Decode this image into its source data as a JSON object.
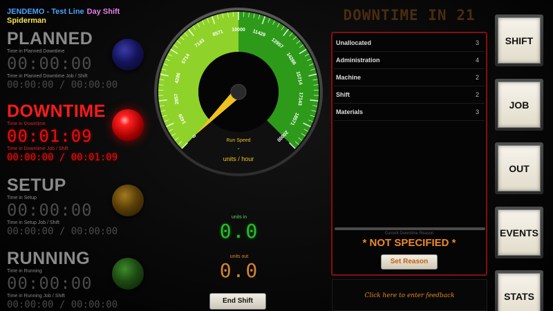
{
  "header": {
    "site": "JENDEMO",
    "separator": " - ",
    "line": "Test Line",
    "shift": "Day Shift",
    "user": "Spiderman"
  },
  "status_blocks": [
    {
      "key": "planned",
      "title": "PLANNED",
      "time_label": "Time in Planned Downtime",
      "time": "00:00:00",
      "job_label": "Time in Planned Downtime Job / Shift",
      "job_time": "00:00:00 / 00:00:00",
      "lamp": "blue",
      "active": false
    },
    {
      "key": "downtime",
      "title": "DOWNTIME",
      "time_label": "Time in Downtime",
      "time": "00:01:09",
      "job_label": "Time in Downtime Job / Shift",
      "job_time": "00:00:00 / 00:01:09",
      "lamp": "red",
      "active": true
    },
    {
      "key": "setup",
      "title": "SETUP",
      "time_label": "Time in Setup",
      "time": "00:00:00",
      "job_label": "Time in Setup Job / Shift",
      "job_time": "00:00:00 / 00:00:00",
      "lamp": "amber",
      "active": false
    },
    {
      "key": "running",
      "title": "RUNNING",
      "time_label": "Time in Running",
      "time": "00:00:00",
      "job_label": "Time in Running Job / Shift",
      "job_time": "00:00:00 / 00:00:00",
      "lamp": "green",
      "active": false
    }
  ],
  "gauge": {
    "ticks": [
      "0",
      "1429",
      "2857",
      "4286",
      "5714",
      "7143",
      "8571",
      "10000",
      "11429",
      "12857",
      "14286",
      "15714",
      "17143",
      "18571",
      "20000"
    ],
    "min": 0,
    "max": 20000,
    "value": 0,
    "label": "Run Speed",
    "speed_value": "-",
    "units": "units / hour"
  },
  "counters": {
    "in_label": "units in",
    "in_value": "0.0",
    "out_label": "units out",
    "out_value": "0.0"
  },
  "end_shift_label": "End Shift",
  "downtime_panel": {
    "title": "DOWNTIME IN 21",
    "reasons": [
      {
        "name": "Unallocated",
        "count": "3"
      },
      {
        "name": "Administration",
        "count": "4"
      },
      {
        "name": "Machine",
        "count": "2"
      },
      {
        "name": "Shift",
        "count": "2"
      },
      {
        "name": "Materials",
        "count": "3"
      }
    ],
    "current_label": "Current Downtime Reason",
    "current_reason": "* NOT SPECIFIED *",
    "set_reason_label": "Set Reason"
  },
  "feedback_text": "Click here to enter feedback",
  "side_buttons": [
    "SHIFT",
    "JOB",
    "OUT",
    "EVENTS",
    "STATS"
  ],
  "colors": {
    "active_red": "#ff1a1a",
    "gauge_green": "#2e9a1a",
    "gauge_lime": "#8fd22a",
    "needle": "#f0c21f",
    "accent_orange": "#f08a1f"
  }
}
